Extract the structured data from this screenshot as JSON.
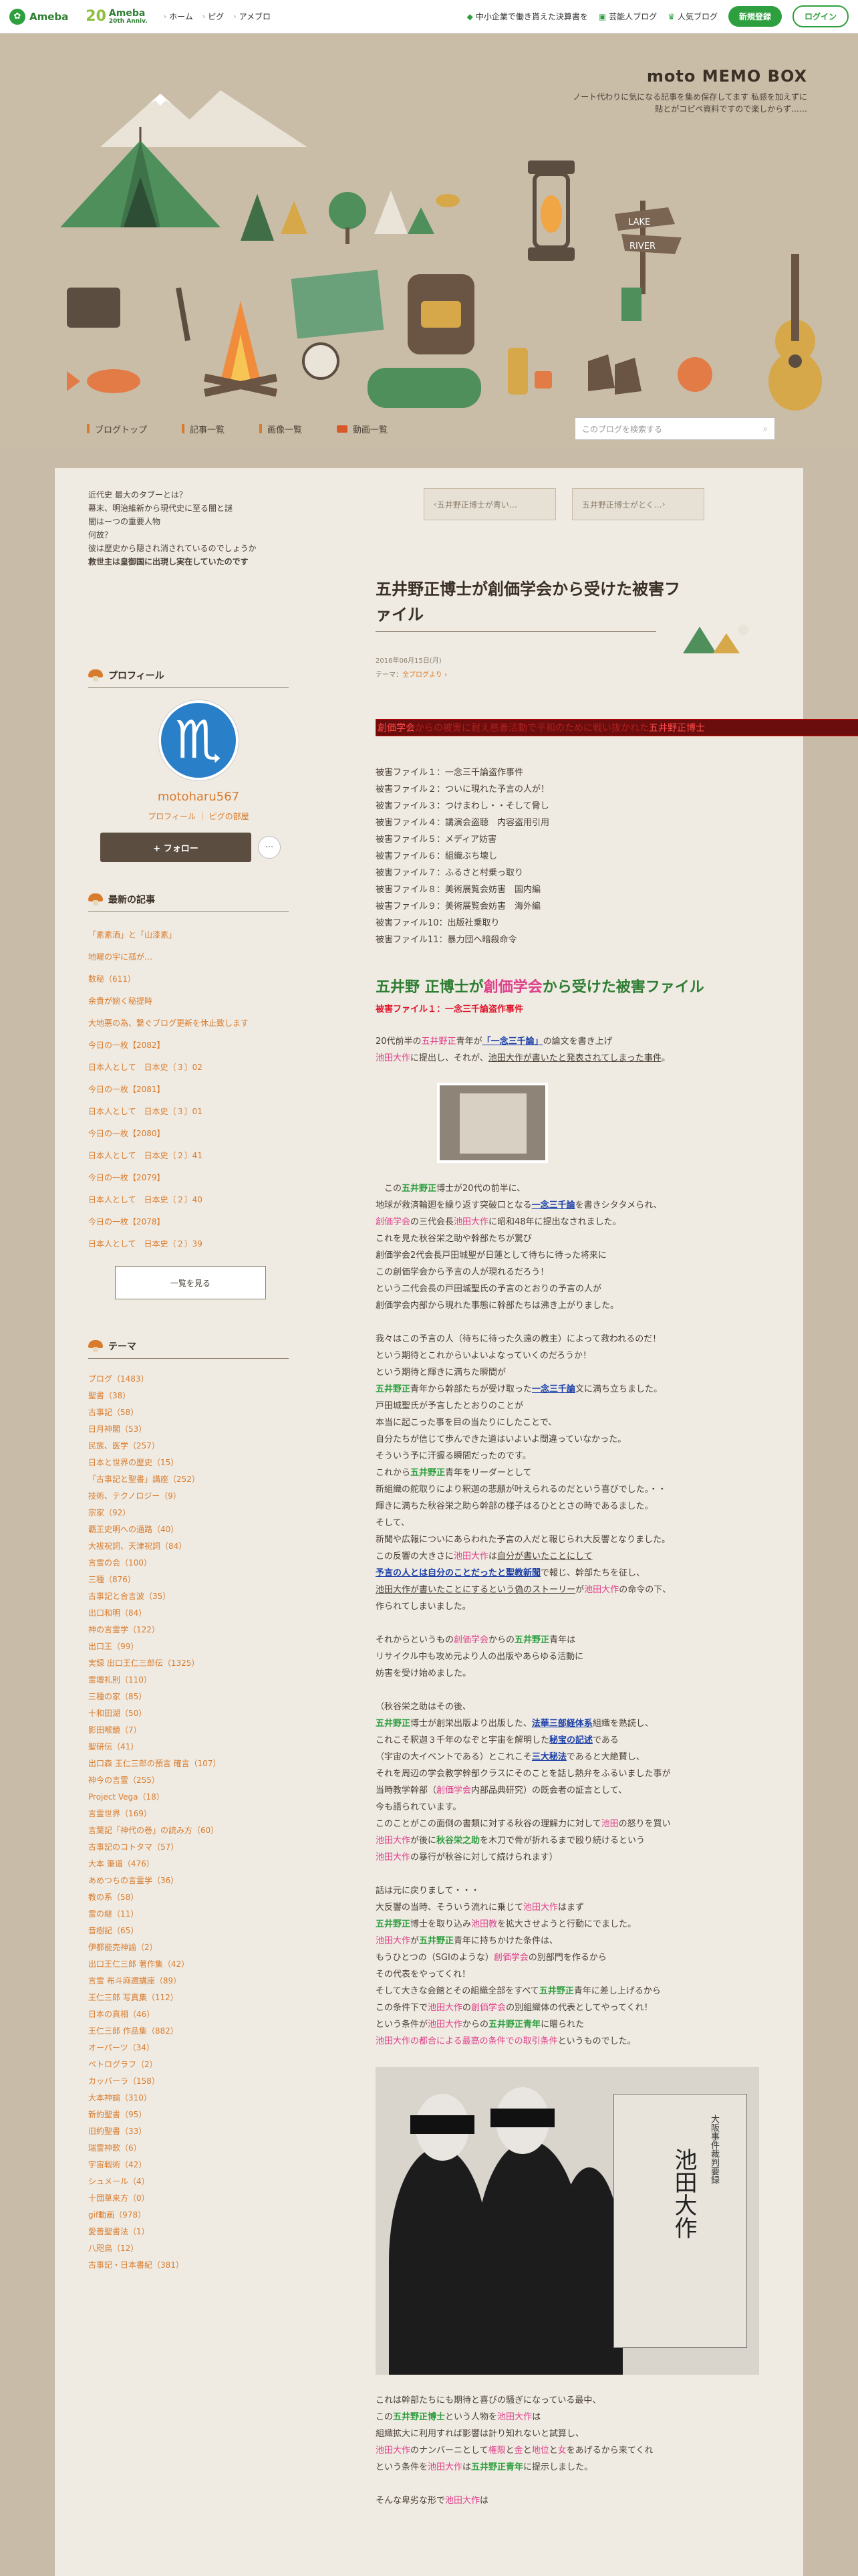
{
  "global_header": {
    "brand": "Ameba",
    "anniv": "20",
    "anniv_brand": "Ameba",
    "anniv_sub": "20th Anniv.",
    "nav": [
      "ホーム",
      "ピグ",
      "アメブロ"
    ],
    "right": [
      "中小企業で働き貰えた決算書を",
      "芸能人ブログ",
      "人気ブログ"
    ],
    "register": "新規登録",
    "login": "ログイン"
  },
  "blog_header": {
    "title": "moto MEMO BOX",
    "desc": "ノート代わりに気になる記事を集め保存してます\n私感を加えずに貼とがコピペ資料ですので楽しからず……"
  },
  "blog_nav": {
    "items": [
      "ブログトップ",
      "記事一覧",
      "画像一覧",
      "動画一覧"
    ],
    "search_placeholder": "このブログを検索する"
  },
  "sidebar": {
    "intro": [
      "近代史 最大のタブーとは？",
      "幕末、明治維新から現代史に至る闇と謎",
      "闇はーつの重要人物",
      "何故？",
      "彼は歴史から隠され消されているのでしょうか",
      "救世主は皇御国に出現し実在していたのです"
    ],
    "profile_title": "プロフィール",
    "username": "motoharu567",
    "profile_links": "プロフィール ｜ ピグの部屋",
    "follow": "+ フォロー",
    "more": "···",
    "recent_title": "最新の記事",
    "recent": [
      "「素素酒」と「山漆素」",
      "地曜の宇に孤が…",
      "数秘（611）",
      "余貴が婉く秘提時",
      "大地悪の為、繋ぐブログ更新を休止致します",
      "今日の一枚【2082】",
      "日本人として　日本史〔３〕02",
      "今日の一枚【2081】",
      "日本人として　日本史〔３〕01",
      "今日の一枚【2080】",
      "日本人として　日本史〔２〕41",
      "今日の一枚【2079】",
      "日本人として　日本史〔２〕40",
      "今日の一枚【2078】",
      "日本人として　日本史〔２〕39"
    ],
    "seeall": "一覧を見る",
    "themes_title": "テーマ",
    "themes": [
      "ブログ（1483）",
      "聖書（38）",
      "古事記（58）",
      "日月神閣（53）",
      "民族、医学（257）",
      "日本と世界の歴史（15）",
      "「古事記と聖書」講座（252）",
      "技術、テクノロジー（9）",
      "宗家（92）",
      "覇王史明への通路（40）",
      "大祓祝詞、天津祝詞（84）",
      "言霊の会（100）",
      "三種（876）",
      "古事記と合言波（35）",
      "出口和明（84）",
      "神の言霊学（122）",
      "出口王（99）",
      "実録 出口王仁三郎伝（1325）",
      "霊壇礼則（110）",
      "三種の家（85）",
      "十和田湖（50）",
      "影田喉鏡（7）",
      "聖研伝（41）",
      "出口森 王仁三郎の預言 確言（107）",
      "神今の言霊（255）",
      "Project Vega（18）",
      "言霊世界（169）",
      "言葉記「神代の巻」の読み方（60）",
      "古事記のコトタマ（57）",
      "大本 筆道（476）",
      "あめつちの言霊学（36）",
      "教の系（58）",
      "霊の継（11）",
      "音樹記（65）",
      "伊都能売神諭（2）",
      "出口王仁三郎 著作集（42）",
      "言霊 布斗麻邇講座（89）",
      "王仁三郎 写真集（112）",
      "日本の真相（46）",
      "王仁三郎 作品集（882）",
      "オーパーツ（34）",
      "ペトログラフ（2）",
      "カッバーラ（158）",
      "大本神諭（310）",
      "新約聖書（95）",
      "旧約聖書（33）",
      "瑞霊神歌（6）",
      "宇宙戦術（42）",
      "シュメール（4）",
      "十団草来方（0）",
      "gif動画（978）",
      "愛善聖書法（1）",
      "八咫鳥（12）",
      "古事記・日本書紀（381）"
    ]
  },
  "main": {
    "pager": [
      "五井野正博士が青い…",
      "五井野正博士がとく…"
    ],
    "title": "五井野正博士が創価学会から受けた被害ファイル",
    "date": "2016年06月15日(月)",
    "theme_label": "テーマ：",
    "theme": "全ブログより ›",
    "redbar": [
      "創価学会",
      "からの被害に耐え慈善活動で平和のために戦い抜かれた",
      "五井野正博士"
    ],
    "files": [
      "被害ファイル１：一念三千論盗作事件",
      "被害ファイル２：ついに現れた予言の人が！",
      "被害ファイル３：つけまわし・・そして脅し",
      "被害ファイル４：講演会盗聴　内容盗用引用",
      "被害ファイル５：メディア妨害",
      "被害ファイル６：組織ぶち壊し",
      "被害ファイル７：ふるさと村乗っ取り",
      "被害ファイル８：美術展覧会妨害　国内編",
      "被害ファイル９：美術展覧会妨害　海外編",
      "被害ファイル10：出版社乗取り",
      "被害ファイル11：暴力団へ暗殺命令"
    ],
    "h2": [
      "五井野 正",
      "博士が",
      "創価学会",
      "から受けた被害ファイル"
    ],
    "h3": "被害ファイル１：一念三千論盗作事件",
    "p1": [
      "20代前半の",
      "五井野正",
      "青年が",
      "「一念三千論」",
      "の論文を書き上げ",
      "池田大作",
      "に提出し、それが、",
      "池田大作が書いたと発表されてしまった事件",
      "。"
    ],
    "body": [
      [
        "　この",
        "五井野正",
        "博士が20代の前半に、"
      ],
      [
        "地球が救済輪廻を繰り返す突破口となる",
        "一念三千論",
        "を書きシタタメられ、"
      ],
      [
        "創価学会",
        "の三代会長",
        "池田大作",
        "に昭和48年に提出なされました。"
      ],
      [
        "これを見た秋谷栄之助や幹部たちが驚び"
      ],
      [
        "創価学会2代会長戸田城聖が日蓮として待ちに待った将来に"
      ],
      [
        "この創価学会から予言の人が現れるだろう！"
      ],
      [
        "という二代会長の戸田城聖氏の予言のとおりの予言の人が"
      ],
      [
        "創価学会内部から現れた事態に幹部たちは沸き上がりました。"
      ],
      [
        ""
      ],
      [
        "我々はこの予言の人（待ちに待った久遠の教主）によって救われるのだ！"
      ],
      [
        "という期待とこれからいよいよなっていくのだろうか！"
      ],
      [
        "という期待と輝きに満ちた瞬間が"
      ],
      [
        "五井野正",
        "青年から幹部たちが受け取った",
        "一念三千論",
        "文に満ち立ちました。"
      ],
      [
        "戸田城聖氏が予言したとおりのことが"
      ],
      [
        "本当に起こった事を目の当たりにしたことで、"
      ],
      [
        "自分たちが信じて歩んできた道はいよいよ間違っていなかった。"
      ],
      [
        "そういう予に汗握る瞬間だったのです。"
      ],
      [
        "これから",
        "五井野正",
        "青年をリーダーとして"
      ],
      [
        "新組織の舵取りにより釈迦の悲願が叶えられるのだという喜びでした。・・"
      ],
      [
        "輝きに満ちた秋谷栄之助ら幹部の様子はるひととさの時であるました。"
      ],
      [
        "そして、"
      ],
      [
        "新聞や広報についにあらわれた予言の人だと報じられ大反響となりました。"
      ],
      [
        "この反響の大きさに",
        "池田大作",
        "は",
        "自分が書いたことにして"
      ],
      [
        "予言の人とは自分のことだったと聖教新聞",
        "で報じ、幹部たちを征し、"
      ],
      [
        "池田大作が書いたことにすると",
        "いう偽のストーリー",
        "が",
        "池田大作",
        "の命令の下、"
      ],
      [
        "作られてしまいました。"
      ],
      [
        ""
      ],
      [
        "それからというもの",
        "創価学会",
        "からの",
        "五井野正",
        "青年は"
      ],
      [
        "リサイクル中も攻め元より人の出版やあらゆる活動に"
      ],
      [
        "妨害を受け始めました。"
      ],
      [
        ""
      ],
      [
        "（秋谷栄之助はその後、"
      ],
      [
        "五井野正",
        "博士が",
        "創栄出版",
        "より出版した、",
        "法華三部経体系",
        "組織を熟読し、"
      ],
      [
        "これこそ釈迦３千年のなぞと宇宙を解明した",
        "秘宝の記述",
        "である"
      ],
      [
        "（宇宙の大イベントである）とこれこそ",
        "三大秘法",
        "であると大絶賛し、"
      ],
      [
        "それを周辺の学会教学幹部クラスにそのことを話し熱弁をふるいました事が"
      ],
      [
        "当時教学幹部（",
        "創価学会",
        "内部品典研究）の既会者の証言として、"
      ],
      [
        "今も語られています。"
      ],
      [
        "このことがこの面倒の書類に対する秋谷の理解力に対して",
        "池田",
        "の怒りを買い"
      ],
      [
        "池田大作",
        "が後に",
        "秋谷栄之助",
        "を木刀で骨が折れるまで殴り続けるという"
      ],
      [
        "池田大作",
        "の暴行が秋谷に対して続けられます）"
      ],
      [
        ""
      ],
      [
        "話は元に戻りまして・・・"
      ],
      [
        "大反響の当時、そういう流れに乗じて",
        "池田大作",
        "はまず"
      ],
      [
        "五井野正",
        "博士を取り込み",
        "池田教",
        "を拡大させようと行動にでました。"
      ],
      [
        "池田大作",
        "が",
        "五井野正",
        "青年に持ちかけた条件は、"
      ],
      [
        "もうひとつの（SGIのような）",
        "創価学会",
        "の別部門を作るから"
      ],
      [
        "その代表をやってくれ！"
      ],
      [
        "そして大きな会館とその組織全部をすべて",
        "五井野正",
        "青年に差し上げるから"
      ],
      [
        "この条件下で",
        "池田大作",
        "の",
        "創価学会",
        "の別組織体の代表としてやってくれ！"
      ],
      [
        "という条件が",
        "池田大作",
        "からの",
        "五井野正青年",
        "に贈られた"
      ],
      [
        "池田大作の都合による最高の条件での取引条件",
        "というものでした。"
      ]
    ],
    "caption_block": {
      "book_title": "池田大作",
      "book_sub": "大阪事件裁判要録"
    },
    "after": [
      [
        "これは幹部たちにも期待と喜びの騒ぎになっている最中、"
      ],
      [
        "この",
        "五井野正博士",
        "という人物を",
        "池田大作",
        "は"
      ],
      [
        "組織拡大に利用すれば影響は計り知れないと試算し、"
      ],
      [
        "池田大作",
        "のナンバーニとして",
        "権限",
        "と",
        "金",
        "と",
        "地位",
        "と",
        "女",
        "をあげるから来てくれ"
      ],
      [
        "という条件を",
        "池田大作",
        "は",
        "五井野正青年",
        "に提示しました。"
      ],
      [
        ""
      ],
      [
        "そんな卑劣な形で",
        "池田大作",
        "は"
      ]
    ]
  }
}
